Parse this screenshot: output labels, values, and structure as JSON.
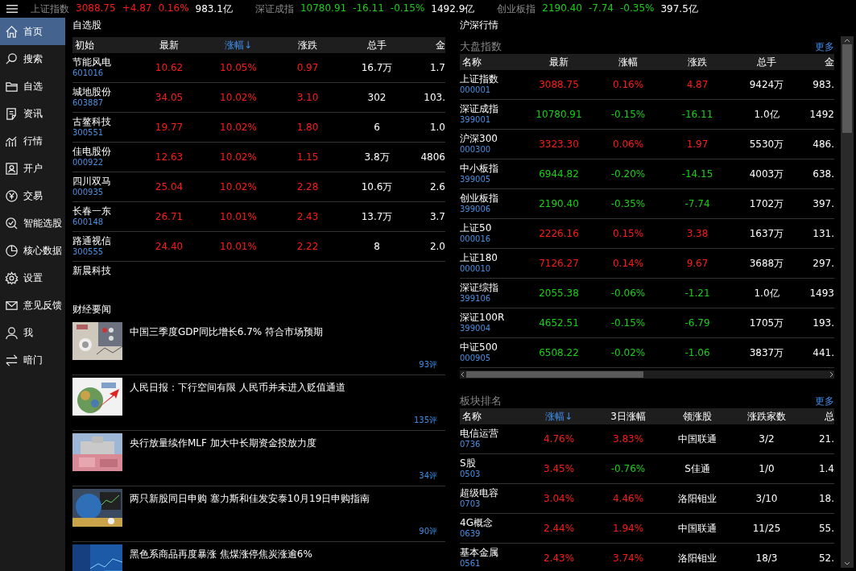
{
  "ticker": [
    {
      "name": "上证指数",
      "value": "3088.75",
      "change": "+4.87",
      "percent": "0.16%",
      "amount": "983.1亿",
      "color": "#ff1a1a"
    },
    {
      "name": "深证成指",
      "value": "10780.91",
      "change": "-16.11",
      "percent": "-0.15%",
      "amount": "1492.9亿",
      "color": "#18d018"
    },
    {
      "name": "创业板指",
      "value": "2190.40",
      "change": "-7.74",
      "percent": "-0.35%",
      "amount": "397.5亿",
      "color": "#18d018"
    }
  ],
  "sidebar": {
    "items": [
      {
        "label": "首页",
        "selected": true
      },
      {
        "label": "搜索",
        "selected": false
      },
      {
        "label": "自选",
        "selected": false
      },
      {
        "label": "资讯",
        "selected": false
      },
      {
        "label": "行情",
        "selected": false
      },
      {
        "label": "开户",
        "selected": false
      },
      {
        "label": "交易",
        "selected": false
      },
      {
        "label": "智能选股",
        "selected": false
      },
      {
        "label": "核心数据",
        "selected": false
      },
      {
        "label": "设置",
        "selected": false
      },
      {
        "label": "意见反馈",
        "selected": false
      },
      {
        "label": "我",
        "selected": false
      },
      {
        "label": "暗门",
        "selected": false
      }
    ]
  },
  "watchlist": {
    "title": "自选股",
    "columns": [
      {
        "label": "初始",
        "sorted": false
      },
      {
        "label": "最新",
        "sorted": false
      },
      {
        "label": "涨幅↓",
        "sorted": true
      },
      {
        "label": "涨跌",
        "sorted": false
      },
      {
        "label": "总手",
        "sorted": false
      },
      {
        "label": "金",
        "sorted": false
      }
    ],
    "rows": [
      {
        "cells": [
          {
            "text": "节能风电",
            "code": "601016"
          },
          {
            "text": "10.62",
            "color": "#ff1a1a"
          },
          {
            "text": "10.05%",
            "color": "#ff1a1a"
          },
          {
            "text": "0.97",
            "color": "#ff1a1a"
          },
          {
            "text": "16.7万"
          },
          {
            "text": "1.7"
          }
        ]
      },
      {
        "cells": [
          {
            "text": "城地股份",
            "code": "603887"
          },
          {
            "text": "34.05",
            "color": "#ff1a1a"
          },
          {
            "text": "10.02%",
            "color": "#ff1a1a"
          },
          {
            "text": "3.10",
            "color": "#ff1a1a"
          },
          {
            "text": "302"
          },
          {
            "text": "103."
          }
        ]
      },
      {
        "cells": [
          {
            "text": "古鳌科技",
            "code": "300551"
          },
          {
            "text": "19.77",
            "color": "#ff1a1a"
          },
          {
            "text": "10.02%",
            "color": "#ff1a1a"
          },
          {
            "text": "1.80",
            "color": "#ff1a1a"
          },
          {
            "text": "6"
          },
          {
            "text": "1.0"
          }
        ]
      },
      {
        "cells": [
          {
            "text": "佳电股份",
            "code": "000922"
          },
          {
            "text": "12.63",
            "color": "#ff1a1a"
          },
          {
            "text": "10.02%",
            "color": "#ff1a1a"
          },
          {
            "text": "1.15",
            "color": "#ff1a1a"
          },
          {
            "text": "3.8万"
          },
          {
            "text": "4806"
          }
        ]
      },
      {
        "cells": [
          {
            "text": "四川双马",
            "code": "000935"
          },
          {
            "text": "25.04",
            "color": "#ff1a1a"
          },
          {
            "text": "10.02%",
            "color": "#ff1a1a"
          },
          {
            "text": "2.28",
            "color": "#ff1a1a"
          },
          {
            "text": "10.6万"
          },
          {
            "text": "2.6"
          }
        ]
      },
      {
        "cells": [
          {
            "text": "长春一东",
            "code": "600148"
          },
          {
            "text": "26.71",
            "color": "#ff1a1a"
          },
          {
            "text": "10.01%",
            "color": "#ff1a1a"
          },
          {
            "text": "2.43",
            "color": "#ff1a1a"
          },
          {
            "text": "13.7万"
          },
          {
            "text": "3.7"
          }
        ]
      },
      {
        "cells": [
          {
            "text": "路通视信",
            "code": "300555"
          },
          {
            "text": "24.40",
            "color": "#ff1a1a"
          },
          {
            "text": "10.01%",
            "color": "#ff1a1a"
          },
          {
            "text": "2.22",
            "color": "#ff1a1a"
          },
          {
            "text": "8"
          },
          {
            "text": "2.0"
          }
        ]
      },
      {
        "cells": [
          {
            "text": "新晨科技"
          }
        ]
      }
    ]
  },
  "news": {
    "title": "财经要闻",
    "items": [
      {
        "title": "中国三季度GDP同比增长6.7% 符合市场预期",
        "comments": "93评"
      },
      {
        "title": "人民日报：下行空间有限 人民币并未进入贬值通道",
        "comments": "135评"
      },
      {
        "title": "央行放量续作MLF  加大中长期资金投放力度",
        "comments": "34评"
      },
      {
        "title": "两只新股同日申购 塞力斯和佳发安泰10月19日申购指南",
        "comments": "90评"
      },
      {
        "title": "黑色系商品再度暴涨 焦煤涨停焦炭涨逾6%"
      }
    ]
  },
  "market": {
    "title": "沪深行情",
    "index_panel": {
      "title": "大盘指数",
      "more": "更多",
      "columns": [
        {
          "label": "名称",
          "sorted": false
        },
        {
          "label": "最新",
          "sorted": false
        },
        {
          "label": "涨幅",
          "sorted": false
        },
        {
          "label": "涨跌",
          "sorted": false
        },
        {
          "label": "总手",
          "sorted": false
        },
        {
          "label": "金",
          "sorted": false
        }
      ],
      "rows": [
        {
          "cells": [
            {
              "text": "上证指数",
              "code": "000001"
            },
            {
              "text": "3088.75",
              "color": "#ff1a1a"
            },
            {
              "text": "0.16%",
              "color": "#ff1a1a"
            },
            {
              "text": "4.87",
              "color": "#ff1a1a"
            },
            {
              "text": "9424万"
            },
            {
              "text": "983."
            }
          ]
        },
        {
          "cells": [
            {
              "text": "深证成指",
              "code": "399001"
            },
            {
              "text": "10780.91",
              "color": "#18d018"
            },
            {
              "text": "-0.15%",
              "color": "#18d018"
            },
            {
              "text": "-16.11",
              "color": "#18d018"
            },
            {
              "text": "1.0亿"
            },
            {
              "text": "1492"
            }
          ]
        },
        {
          "cells": [
            {
              "text": "沪深300",
              "code": "000300"
            },
            {
              "text": "3323.30",
              "color": "#ff1a1a"
            },
            {
              "text": "0.06%",
              "color": "#ff1a1a"
            },
            {
              "text": "1.97",
              "color": "#ff1a1a"
            },
            {
              "text": "5530万"
            },
            {
              "text": "486."
            }
          ]
        },
        {
          "cells": [
            {
              "text": "中小板指",
              "code": "399005"
            },
            {
              "text": "6944.82",
              "color": "#18d018"
            },
            {
              "text": "-0.20%",
              "color": "#18d018"
            },
            {
              "text": "-14.15",
              "color": "#18d018"
            },
            {
              "text": "4003万"
            },
            {
              "text": "638."
            }
          ]
        },
        {
          "cells": [
            {
              "text": "创业板指",
              "code": "399006"
            },
            {
              "text": "2190.40",
              "color": "#18d018"
            },
            {
              "text": "-0.35%",
              "color": "#18d018"
            },
            {
              "text": "-7.74",
              "color": "#18d018"
            },
            {
              "text": "1702万"
            },
            {
              "text": "397."
            }
          ]
        },
        {
          "cells": [
            {
              "text": "上证50",
              "code": "000016"
            },
            {
              "text": "2226.16",
              "color": "#ff1a1a"
            },
            {
              "text": "0.15%",
              "color": "#ff1a1a"
            },
            {
              "text": "3.38",
              "color": "#ff1a1a"
            },
            {
              "text": "1637万"
            },
            {
              "text": "131."
            }
          ]
        },
        {
          "cells": [
            {
              "text": "上证180",
              "code": "000010"
            },
            {
              "text": "7126.27",
              "color": "#ff1a1a"
            },
            {
              "text": "0.14%",
              "color": "#ff1a1a"
            },
            {
              "text": "9.67",
              "color": "#ff1a1a"
            },
            {
              "text": "3688万"
            },
            {
              "text": "297."
            }
          ]
        },
        {
          "cells": [
            {
              "text": "深证综指",
              "code": "399106"
            },
            {
              "text": "2055.38",
              "color": "#18d018"
            },
            {
              "text": "-0.06%",
              "color": "#18d018"
            },
            {
              "text": "-1.21",
              "color": "#18d018"
            },
            {
              "text": "1.0亿"
            },
            {
              "text": "1493"
            }
          ]
        },
        {
          "cells": [
            {
              "text": "深证100R",
              "code": "399004"
            },
            {
              "text": "4652.51",
              "color": "#18d018"
            },
            {
              "text": "-0.15%",
              "color": "#18d018"
            },
            {
              "text": "-6.79",
              "color": "#18d018"
            },
            {
              "text": "1705万"
            },
            {
              "text": "193."
            }
          ]
        },
        {
          "cells": [
            {
              "text": "中证500",
              "code": "000905"
            },
            {
              "text": "6508.22",
              "color": "#18d018"
            },
            {
              "text": "-0.02%",
              "color": "#18d018"
            },
            {
              "text": "-1.06",
              "color": "#18d018"
            },
            {
              "text": "3837万"
            },
            {
              "text": "441."
            }
          ]
        }
      ]
    },
    "sector_panel": {
      "title": "板块排名",
      "more": "更多",
      "columns": [
        {
          "label": "名称",
          "sorted": false
        },
        {
          "label": "涨幅↓",
          "sorted": true
        },
        {
          "label": "3日涨幅",
          "sorted": false
        },
        {
          "label": "领涨股",
          "sorted": false
        },
        {
          "label": "涨跌家数",
          "sorted": false
        },
        {
          "label": "总",
          "sorted": false
        }
      ],
      "rows": [
        {
          "cells": [
            {
              "text": "电信运营",
              "code": "0736"
            },
            {
              "text": "4.76%",
              "color": "#ff1a1a"
            },
            {
              "text": "3.83%",
              "color": "#ff1a1a"
            },
            {
              "text": "中国联通"
            },
            {
              "text": "3/2"
            },
            {
              "text": "21."
            }
          ]
        },
        {
          "cells": [
            {
              "text": "S股",
              "code": "0503"
            },
            {
              "text": "3.45%",
              "color": "#ff1a1a"
            },
            {
              "text": "-0.76%",
              "color": "#18d018"
            },
            {
              "text": "S佳通"
            },
            {
              "text": "1/0"
            },
            {
              "text": "1.4"
            }
          ]
        },
        {
          "cells": [
            {
              "text": "超级电容",
              "code": "0703"
            },
            {
              "text": "3.04%",
              "color": "#ff1a1a"
            },
            {
              "text": "4.46%",
              "color": "#ff1a1a"
            },
            {
              "text": "洛阳钼业"
            },
            {
              "text": "3/10"
            },
            {
              "text": "18."
            }
          ]
        },
        {
          "cells": [
            {
              "text": "4G概念",
              "code": "0639"
            },
            {
              "text": "2.44%",
              "color": "#ff1a1a"
            },
            {
              "text": "1.94%",
              "color": "#ff1a1a"
            },
            {
              "text": "中国联通"
            },
            {
              "text": "11/25"
            },
            {
              "text": "55."
            }
          ]
        },
        {
          "cells": [
            {
              "text": "基本金属",
              "code": "0561"
            },
            {
              "text": "2.43%",
              "color": "#ff1a1a"
            },
            {
              "text": "3.74%",
              "color": "#ff1a1a"
            },
            {
              "text": "洛阳钼业"
            },
            {
              "text": "18/3"
            },
            {
              "text": "52."
            }
          ]
        }
      ]
    }
  }
}
